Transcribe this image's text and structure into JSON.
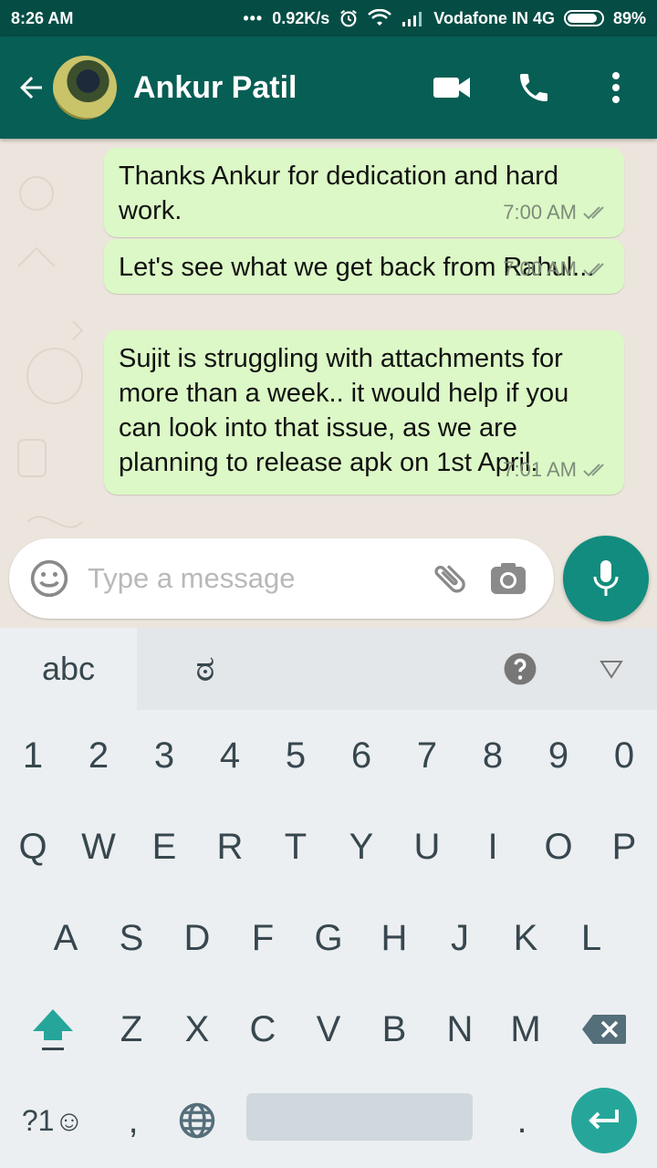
{
  "status_bar": {
    "time": "8:26 AM",
    "net_speed": "0.92K/s",
    "carrier": "Vodafone IN 4G",
    "battery": "89%",
    "battery_level": 0.89
  },
  "header": {
    "contact_name": "Ankur Patil"
  },
  "messages": [
    {
      "text": "Thanks Ankur for dedication and hard work.",
      "time": "7:00 AM"
    },
    {
      "text": "Let's see what we get back from Rahul...",
      "time": "7:00 AM"
    },
    {
      "text": "Sujit is struggling with attachments for more than a week.. it would help if you can look into that issue, as we are planning to release apk on 1st April.",
      "time": "7:01 AM"
    }
  ],
  "composer": {
    "placeholder": "Type a message"
  },
  "keyboard": {
    "tab_abc": "abc",
    "tab_script": "ಠ",
    "digits": [
      "1",
      "2",
      "3",
      "4",
      "5",
      "6",
      "7",
      "8",
      "9",
      "0"
    ],
    "row_q": [
      "Q",
      "W",
      "E",
      "R",
      "T",
      "Y",
      "U",
      "I",
      "O",
      "P"
    ],
    "row_a": [
      "A",
      "S",
      "D",
      "F",
      "G",
      "H",
      "J",
      "K",
      "L"
    ],
    "row_z": [
      "Z",
      "X",
      "C",
      "V",
      "B",
      "N",
      "M"
    ],
    "symbols_key": "?1☺",
    "comma_key": ",",
    "period_key": "."
  },
  "colors": {
    "header": "#075e54",
    "status_bar": "#054d44",
    "bubble_out": "#dcf8c6",
    "fab": "#128c7e",
    "enter_key": "#26a69a"
  }
}
